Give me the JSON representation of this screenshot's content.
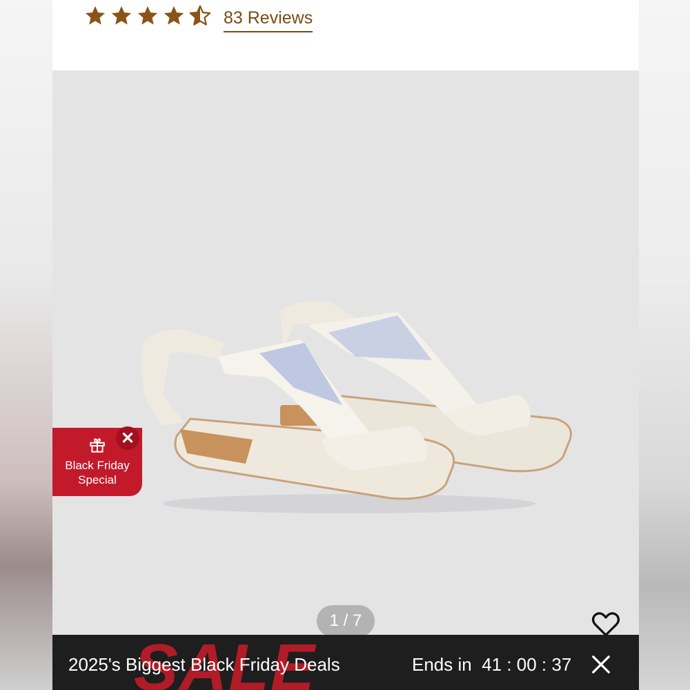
{
  "rating": {
    "value": 4.5,
    "max": 5,
    "reviews_label": "83 Reviews",
    "star_color": "#8a5418"
  },
  "gallery": {
    "counter": "1 / 7",
    "background": "#e4e4e5",
    "image_icon": "sandal-product-image"
  },
  "promo": {
    "line1": "Black Friday",
    "line2": "Special",
    "icon": "gift-icon",
    "color": "#c21a2a"
  },
  "banner": {
    "sale_word": "SALE",
    "title": "2025's Biggest Black Friday Deals",
    "ends_label": "Ends in",
    "countdown": "41 : 00 : 37",
    "background": "#1e1e1e"
  }
}
